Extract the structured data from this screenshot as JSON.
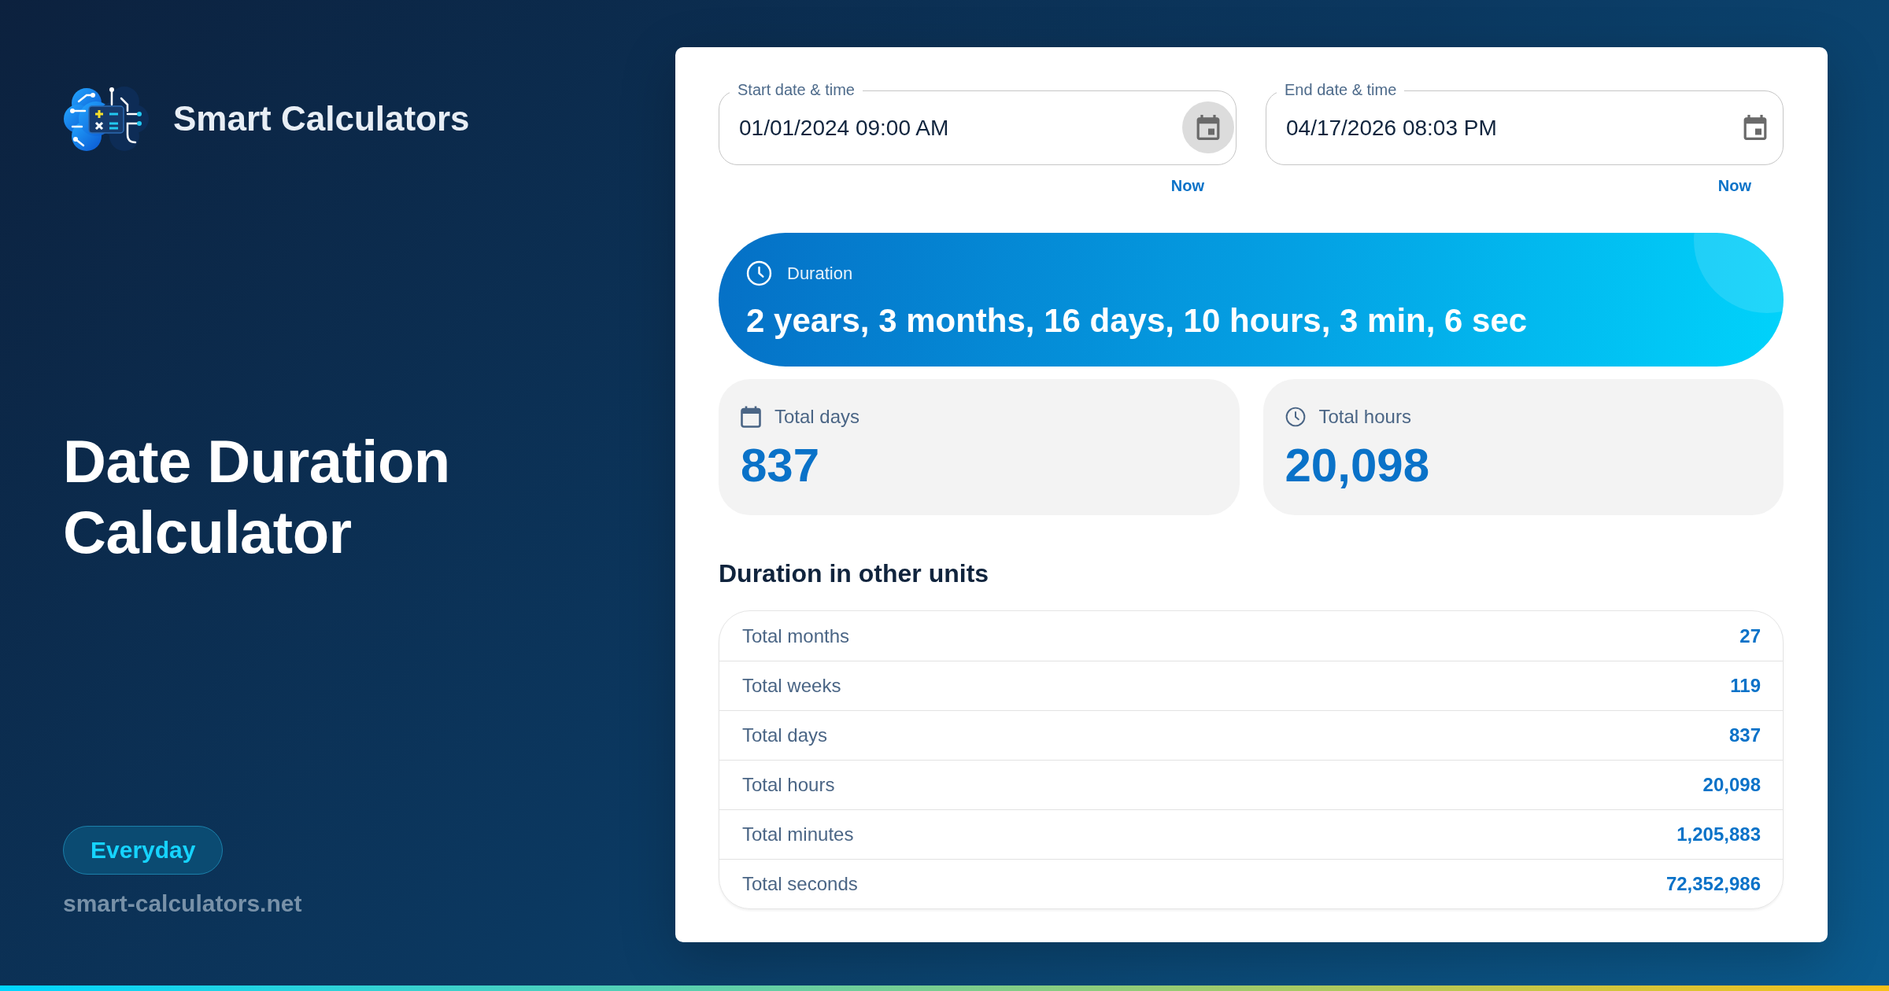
{
  "brand": {
    "name": "Smart Calculators"
  },
  "hero": {
    "title": "Date Duration Calculator",
    "category_badge": "Everyday",
    "site_url": "smart-calculators.net"
  },
  "inputs": [
    {
      "label": "Start date & time",
      "value": "01/01/2024 09:00 AM",
      "picker_highlighted": true,
      "now_link": "Now"
    },
    {
      "label": "End date & time",
      "value": "04/17/2026 08:03 PM",
      "picker_highlighted": false,
      "now_link": "Now"
    }
  ],
  "duration": {
    "label": "Duration",
    "value": "2 years, 3 months, 16 days, 10 hours, 3 min, 6 sec"
  },
  "summary_cards": [
    {
      "kind": "days",
      "label": "Total days",
      "value": "837"
    },
    {
      "kind": "hours",
      "label": "Total hours",
      "value": "20,098"
    }
  ],
  "units_table": {
    "title": "Duration in other units",
    "rows": [
      {
        "label": "Total months",
        "value": "27"
      },
      {
        "label": "Total weeks",
        "value": "119"
      },
      {
        "label": "Total days",
        "value": "837"
      },
      {
        "label": "Total hours",
        "value": "20,098"
      },
      {
        "label": "Total minutes",
        "value": "1,205,883"
      },
      {
        "label": "Total seconds",
        "value": "72,352,986"
      }
    ]
  }
}
